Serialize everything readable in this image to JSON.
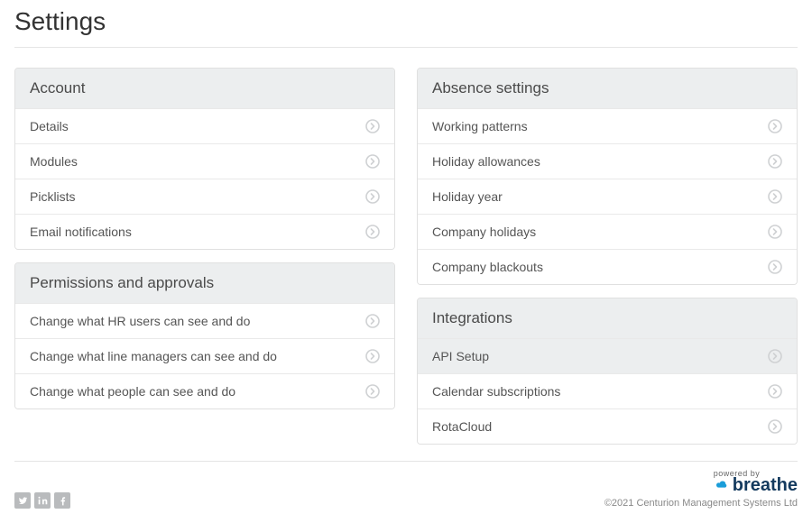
{
  "title": "Settings",
  "panels": {
    "account": {
      "heading": "Account",
      "items": [
        {
          "label": "Details"
        },
        {
          "label": "Modules"
        },
        {
          "label": "Picklists"
        },
        {
          "label": "Email notifications"
        }
      ]
    },
    "permissions": {
      "heading": "Permissions and approvals",
      "items": [
        {
          "label": "Change what HR users can see and do"
        },
        {
          "label": "Change what line managers can see and do"
        },
        {
          "label": "Change what people can see and do"
        }
      ]
    },
    "absence": {
      "heading": "Absence settings",
      "items": [
        {
          "label": "Working patterns"
        },
        {
          "label": "Holiday allowances"
        },
        {
          "label": "Holiday year"
        },
        {
          "label": "Company holidays"
        },
        {
          "label": "Company blackouts"
        }
      ]
    },
    "integrations": {
      "heading": "Integrations",
      "items": [
        {
          "label": "API Setup",
          "highlight": true
        },
        {
          "label": "Calendar subscriptions"
        },
        {
          "label": "RotaCloud"
        }
      ]
    }
  },
  "footer": {
    "powered_by": "powered by",
    "brand": "breathe",
    "copyright": "©2021 Centurion Management Systems Ltd"
  }
}
